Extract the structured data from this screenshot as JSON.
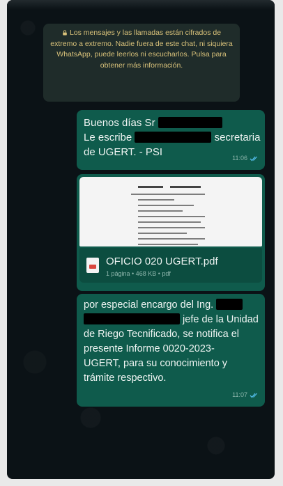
{
  "encryption_notice": {
    "text": "Los mensajes y las llamadas están cifrados de extremo a extremo. Nadie fuera de este chat, ni siquiera WhatsApp, puede leerlos ni escucharlos. Pulsa para obtener más información."
  },
  "messages": [
    {
      "lines": [
        "Buenos días Sr",
        "Le escribe",
        "secretaria",
        "de UGERT. - PSI"
      ],
      "time": "11:06"
    },
    {
      "file_name": "OFICIO 020 UGERT.pdf",
      "file_meta": "1 página • 468 KB • pdf",
      "time": ""
    },
    {
      "lines": [
        "por especial encargo del Ing.",
        "jefe de la Unidad",
        "de Riego Tecnificado, se notifica el",
        "presente Informe 0020-2023-",
        "UGERT, para su conocimiento y",
        "trámite respectivo."
      ],
      "time": "11:07"
    }
  ],
  "colors": {
    "chat_background": "#0b1216",
    "outgoing_bubble": "#0f5b4c",
    "notice_text": "#d9c27a",
    "read_ticks": "#53bdeb"
  }
}
